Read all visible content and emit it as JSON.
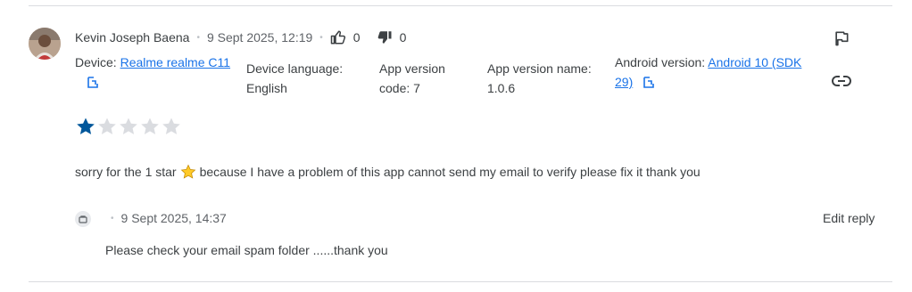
{
  "review": {
    "author": "Kevin Joseph Baena",
    "date": "9 Sept 2025, 12:19",
    "thumbs_up_count": "0",
    "thumbs_down_count": "0",
    "device_label": "Device: ",
    "device_value": "Realme realme C11",
    "language_label": "Device language:",
    "language_value": "English",
    "app_version_label": "App version code: 7",
    "app_version_name_label": "App version name:",
    "app_version_name_value": "1.0.6",
    "android_label": "Android version: ",
    "android_value": "Android 10 (SDK 29)",
    "rating": 1,
    "rating_max": 5,
    "text_before_emoji": "sorry for the 1 star",
    "text_after_emoji": "because I have a problem of this app cannot send my email to verify please fix it thank you"
  },
  "reply": {
    "date": "9 Sept 2025, 14:37",
    "edit_label": "Edit reply",
    "text": "Please check your email spam folder ......thank you"
  },
  "icons": {
    "separator": "•"
  },
  "colors": {
    "star_filled": "#01579b",
    "star_empty": "#dadce0",
    "link": "#1a73e8"
  }
}
